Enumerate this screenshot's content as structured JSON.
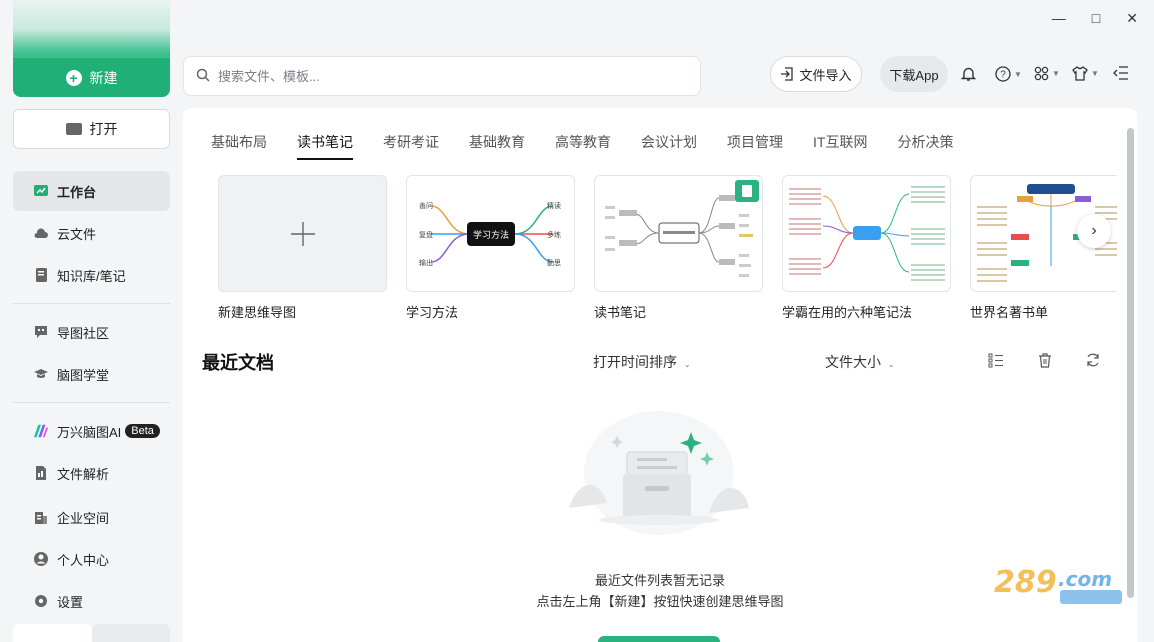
{
  "sidebar": {
    "new_label": "新建",
    "open_label": "打开",
    "items": [
      {
        "label": "工作台"
      },
      {
        "label": "云文件"
      },
      {
        "label": "知识库/笔记"
      },
      {
        "label": "导图社区"
      },
      {
        "label": "脑图学堂"
      },
      {
        "label": "万兴脑图AI",
        "badge": "Beta"
      },
      {
        "label": "文件解析"
      },
      {
        "label": "企业空间"
      },
      {
        "label": "个人中心"
      },
      {
        "label": "设置"
      }
    ]
  },
  "header": {
    "search_placeholder": "搜索文件、模板...",
    "import_label": "文件导入",
    "download_label": "下载App"
  },
  "tabs": [
    "基础布局",
    "读书笔记",
    "考研考证",
    "基础教育",
    "高等教育",
    "会议计划",
    "项目管理",
    "IT互联网",
    "分析决策"
  ],
  "selected_tab": "读书笔记",
  "templates": [
    {
      "label": "新建思维导图"
    },
    {
      "label": "学习方法",
      "center": "学习方法",
      "left": [
        "善问",
        "复盘",
        "输出"
      ],
      "right": [
        "精读",
        "多练",
        "勤思"
      ]
    },
    {
      "label": "读书笔记"
    },
    {
      "label": "学霸在用的六种笔记法"
    },
    {
      "label": "世界名著书单"
    }
  ],
  "recent": {
    "title": "最近文档",
    "sort_label": "打开时间排序",
    "size_label": "文件大小",
    "empty_line1": "最近文件列表暂无记录",
    "empty_line2": "点击左上角【新建】按钮快速创建思维导图"
  },
  "colors": {
    "accent": "#1faf77",
    "active_bg": "#e4e6e9"
  }
}
